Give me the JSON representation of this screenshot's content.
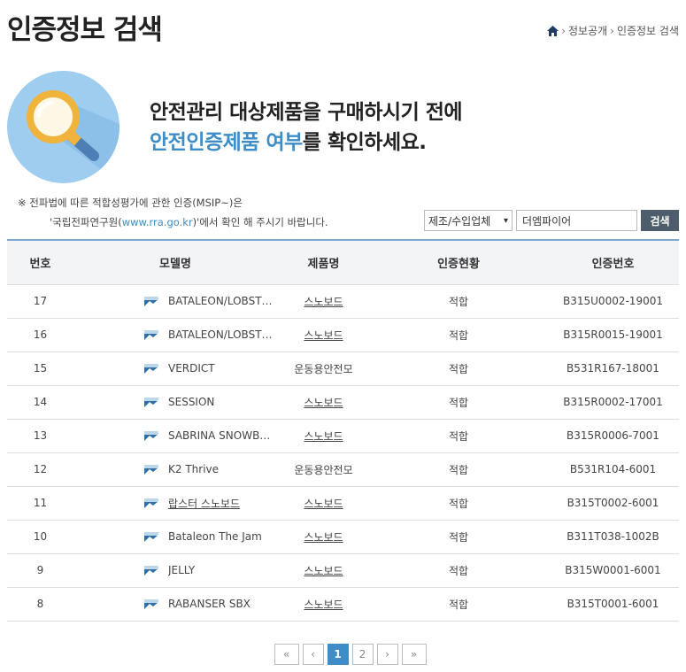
{
  "header": {
    "title": "인증정보 검색",
    "breadcrumb": [
      "정보공개",
      "인증정보 검색"
    ]
  },
  "hero": {
    "line1": "안전관리 대상제품을 구매하시기 전에",
    "line2_accent": "안전인증제품 여부",
    "line2_rest": "를 확인하세요."
  },
  "notice": {
    "line1": "※ 전파법에 따른 적합성평가에 관한 인증(MSIP~)은",
    "line2_pre": "'국립전파연구원(",
    "line2_link": "www.rra.go.kr",
    "line2_post": ")'에서 확인 해 주시기 바랍니다."
  },
  "search": {
    "select_value": "제조/수입업체",
    "input_value": "더엠파이어",
    "button_label": "검색"
  },
  "table": {
    "headers": [
      "번호",
      "모델명",
      "제품명",
      "인증현황",
      "인증번호"
    ],
    "rows": [
      {
        "no": "17",
        "model": "BATALEON/LOBST…",
        "product": "스노보드",
        "product_link": true,
        "status": "적합",
        "cert": "B315U0002-19001"
      },
      {
        "no": "16",
        "model": "BATALEON/LOBST…",
        "product": "스노보드",
        "product_link": true,
        "status": "적합",
        "cert": "B315R0015-19001"
      },
      {
        "no": "15",
        "model": "VERDICT",
        "product": "운동용안전모",
        "product_link": false,
        "status": "적합",
        "cert": "B531R167-18001"
      },
      {
        "no": "14",
        "model": "SESSION",
        "product": "스노보드",
        "product_link": true,
        "status": "적합",
        "cert": "B315R0002-17001"
      },
      {
        "no": "13",
        "model": "SABRINA SNOWB…",
        "product": "스노보드",
        "product_link": true,
        "status": "적합",
        "cert": "B315R0006-7001"
      },
      {
        "no": "12",
        "model": "K2 Thrive",
        "product": "운동용안전모",
        "product_link": false,
        "status": "적합",
        "cert": "B531R104-6001"
      },
      {
        "no": "11",
        "model": "랍스터 스노보드",
        "product": "스노보드",
        "product_link": true,
        "status": "적합",
        "cert": "B315T0002-6001",
        "model_link": true
      },
      {
        "no": "10",
        "model": "Bataleon The Jam",
        "product": "스노보드",
        "product_link": true,
        "status": "적합",
        "cert": "B311T038-1002B"
      },
      {
        "no": "9",
        "model": "JELLY",
        "product": "스노보드",
        "product_link": true,
        "status": "적합",
        "cert": "B315W0001-6001"
      },
      {
        "no": "8",
        "model": "RABANSER SBX",
        "product": "스노보드",
        "product_link": true,
        "status": "적합",
        "cert": "B315T0001-6001"
      }
    ]
  },
  "pagination": {
    "first": "«",
    "prev": "‹",
    "pages": [
      "1",
      "2"
    ],
    "current": "1",
    "next": "›",
    "last": "»"
  },
  "colors": {
    "accent": "#3c8dc8",
    "hero_circle": "#9fcdf0",
    "search_button": "#4e5d6c"
  }
}
